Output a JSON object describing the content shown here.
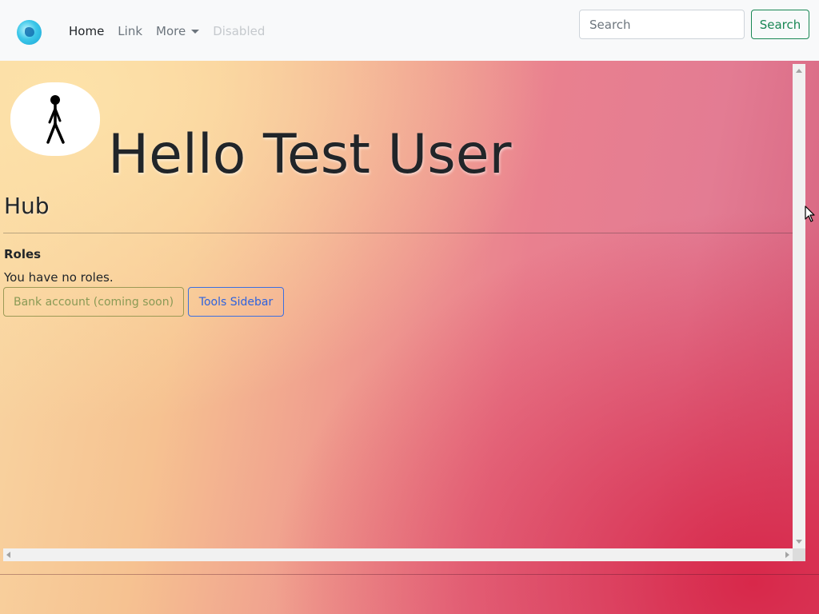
{
  "navbar": {
    "brand_icon": "globe-logo-icon",
    "links": [
      {
        "label": "Home",
        "state": "active"
      },
      {
        "label": "Link",
        "state": "normal"
      },
      {
        "label": "More",
        "state": "dropdown"
      },
      {
        "label": "Disabled",
        "state": "disabled"
      }
    ],
    "search": {
      "placeholder": "Search",
      "value": ""
    },
    "search_button_label": "Search"
  },
  "main": {
    "avatar_icon": "stick-figure-icon",
    "greeting": "Hello Test User",
    "hub_title": "Hub",
    "roles_heading": "Roles",
    "roles_text": "You have no roles.",
    "buttons": {
      "bank": "Bank account (coming soon)",
      "tools": "Tools Sidebar"
    }
  },
  "colors": {
    "success": "#198754",
    "primary": "#2f63dd",
    "bank_button": "#8a9a55"
  }
}
